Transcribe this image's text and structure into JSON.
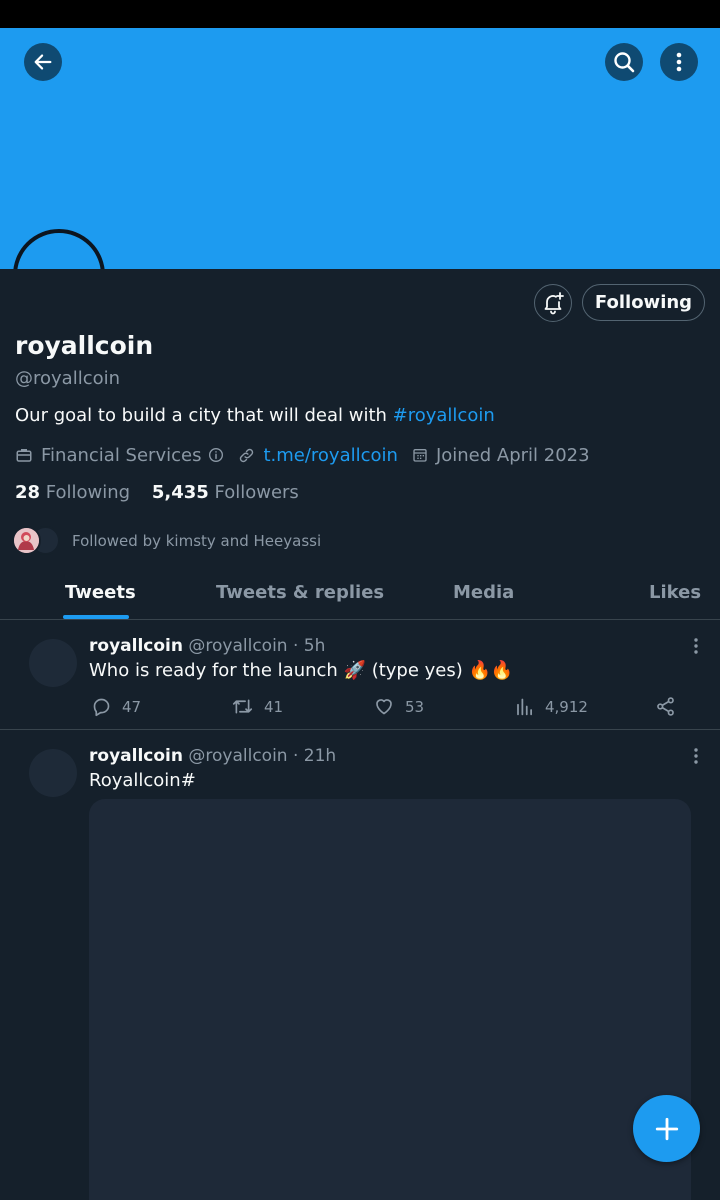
{
  "profile": {
    "name": "royallcoin",
    "handle": "@royallcoin",
    "bio_text": "Our goal to build a city that will deal with ",
    "bio_hashtag": "#royallcoin",
    "category": "Financial Services",
    "link": "t.me/royallcoin",
    "joined": "Joined April 2023",
    "following_count": "28",
    "following_label": "Following",
    "followers_count": "5,435",
    "followers_label": "Followers",
    "followed_by": "Followed by kimsty and Heeyassi"
  },
  "actions": {
    "follow_button": "Following"
  },
  "tabs": [
    {
      "label": "Tweets",
      "active": true
    },
    {
      "label": "Tweets & replies",
      "active": false
    },
    {
      "label": "Media",
      "active": false
    },
    {
      "label": "Likes",
      "active": false
    }
  ],
  "tweets": [
    {
      "name": "royallcoin",
      "handle_time": "@royallcoin · 5h",
      "text": "Who is ready for the launch 🚀 (type yes) 🔥🔥",
      "replies": "47",
      "retweets": "41",
      "likes": "53",
      "views": "4,912"
    },
    {
      "name": "royallcoin",
      "handle_time": "@royallcoin · 21h",
      "text": "Royallcoin#"
    }
  ],
  "icons": [
    "back-arrow-icon",
    "search-icon",
    "more-vertical-icon",
    "bell-plus-icon",
    "briefcase-icon",
    "info-icon",
    "link-icon",
    "calendar-icon",
    "reply-icon",
    "retweet-icon",
    "like-icon",
    "views-icon",
    "share-icon",
    "compose-plus-icon"
  ],
  "colors": {
    "accent": "#1d9bf0",
    "background": "#15202b",
    "muted": "#8b98a5",
    "border": "#38444d"
  }
}
